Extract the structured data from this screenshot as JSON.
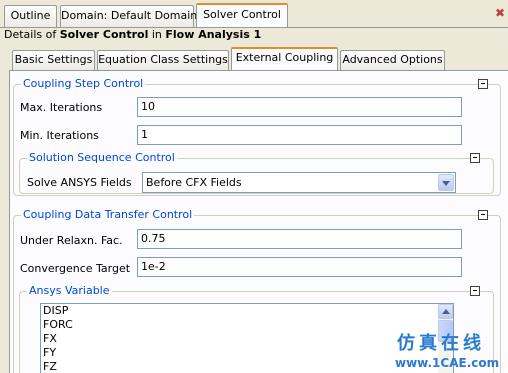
{
  "top_tabs": [
    "Outline",
    "Domain: Default Domain",
    "Solver Control"
  ],
  "details": {
    "prefix": "Details of ",
    "object": "Solver Control",
    "middle": " in ",
    "analysis": "Flow Analysis 1"
  },
  "sub_tabs": [
    "Basic Settings",
    "Equation Class Settings",
    "External Coupling",
    "Advanced Options"
  ],
  "coupling_step_control": {
    "title": "Coupling Step Control",
    "max_iterations": {
      "label": "Max. Iterations",
      "value": "10"
    },
    "min_iterations": {
      "label": "Min. Iterations",
      "value": "1"
    }
  },
  "solution_sequence_control": {
    "title": "Solution Sequence Control",
    "solve_ansys_fields": {
      "label": "Solve ANSYS Fields",
      "value": "Before CFX Fields"
    }
  },
  "coupling_data_transfer_control": {
    "title": "Coupling Data Transfer Control",
    "under_relaxn": {
      "label": "Under Relaxn. Fac.",
      "value": "0.75"
    },
    "convergence_target": {
      "label": "Convergence Target",
      "value": "1e-2"
    }
  },
  "ansys_variable": {
    "title": "Ansys Variable",
    "items": [
      "DISP",
      "FORC",
      "FX",
      "FY",
      "FZ"
    ]
  },
  "watermark": {
    "center": "1CAE.COM",
    "logo": "仿真在线",
    "url": "www.1CAE.com"
  },
  "colors": {
    "group_title": "#0046d5",
    "active_tab_accent": "#e68b2c",
    "watermark": "#2a7bd0"
  },
  "icons": {
    "close": "close-icon",
    "collapse": "collapse-icon",
    "dropdown": "chevron-down-icon"
  }
}
